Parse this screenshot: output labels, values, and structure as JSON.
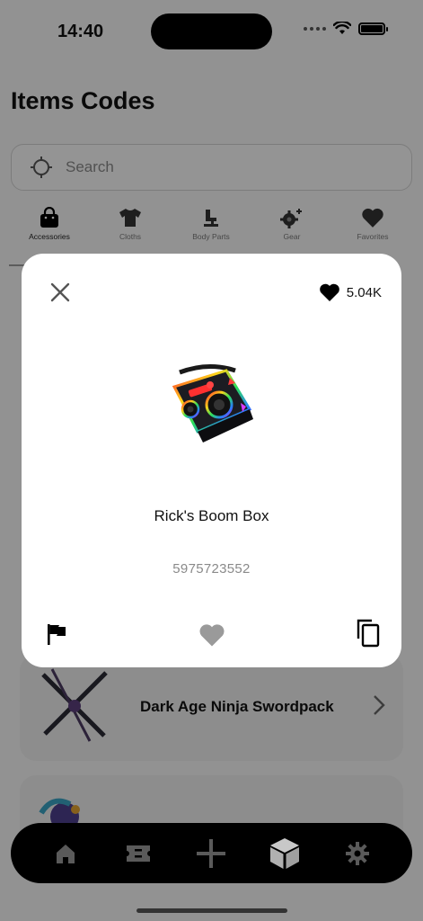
{
  "status_bar": {
    "time": "14:40"
  },
  "page": {
    "title": "Items Codes"
  },
  "search": {
    "placeholder": "Search"
  },
  "categories": [
    {
      "label": "Accessories",
      "icon": "bag-icon",
      "active": true
    },
    {
      "label": "Cloths",
      "icon": "shirt-icon",
      "active": false
    },
    {
      "label": "Body Parts",
      "icon": "body-parts-icon",
      "active": false
    },
    {
      "label": "Gear",
      "icon": "gear-icon",
      "active": false
    },
    {
      "label": "Favorites",
      "icon": "heart-icon",
      "active": false
    }
  ],
  "list": [
    {
      "name": "Dark Age Ninja Swordpack",
      "icon": "swordpack-thumbnail"
    },
    {
      "name": "",
      "icon": "item-thumbnail"
    }
  ],
  "modal": {
    "likes": "5.04K",
    "item_name": "Rick's Boom Box",
    "item_id": "5975723552",
    "image": "boombox-image"
  },
  "bottom_nav": [
    {
      "icon": "home-icon"
    },
    {
      "icon": "ticket-icon"
    },
    {
      "icon": "plus-icon"
    },
    {
      "icon": "cube-icon",
      "active": true
    },
    {
      "icon": "settings-icon"
    }
  ],
  "colors": {
    "background": "#f4f4f4",
    "nav_bg": "#000000",
    "modal_bg": "#ffffff",
    "muted_text": "#8a8a8a",
    "overlay": "rgba(0,0,0,0.40)"
  }
}
